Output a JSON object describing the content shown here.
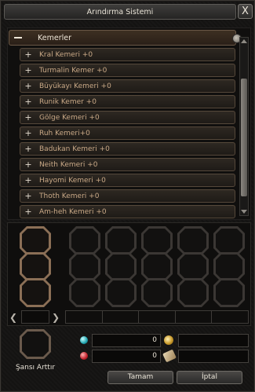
{
  "window": {
    "title": "Arındırma Sistemi",
    "close_label": "X"
  },
  "category": {
    "label": "Kemerler",
    "expanded_symbol": "—"
  },
  "items": [
    {
      "label": "Kral Kemeri +0"
    },
    {
      "label": "Turmalin Kemer +0"
    },
    {
      "label": "Büyükayı Kemeri +0"
    },
    {
      "label": "Runik Kemer +0"
    },
    {
      "label": "Gölge Kemeri +0"
    },
    {
      "label": "Ruh Kemeri+0"
    },
    {
      "label": "Badukan Kemeri +0"
    },
    {
      "label": "Neith Kemeri +0"
    },
    {
      "label": "Hayomi Kemeri +0"
    },
    {
      "label": "Thoth Kemeri +0"
    },
    {
      "label": "Am-heh Kemeri +0"
    }
  ],
  "item_expand_symbol": "+",
  "navigation": {
    "prev_symbol": "❮",
    "next_symbol": "❯"
  },
  "luck": {
    "label": "Şansı Arttır"
  },
  "costs": {
    "first_value": "0",
    "second_value": "0"
  },
  "buttons": {
    "ok": "Tamam",
    "cancel": "İptal"
  },
  "icons": [
    "minus-icon",
    "plus-icon",
    "scroll-up-icon",
    "scroll-down-icon",
    "cyan-gem-icon",
    "red-gem-icon",
    "gold-coin-icon",
    "scroll-item-icon"
  ]
}
